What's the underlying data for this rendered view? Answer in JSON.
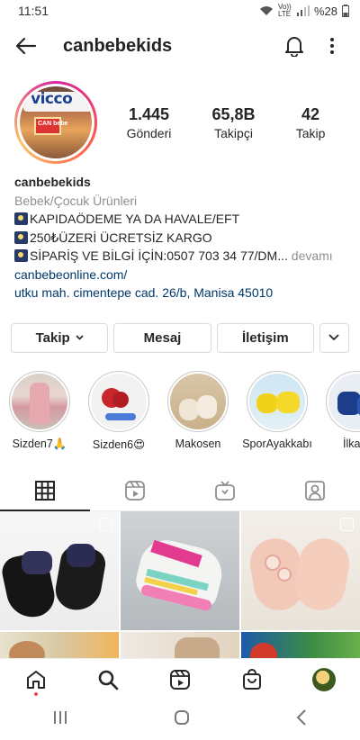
{
  "status": {
    "time": "11:51",
    "network": "Vo)) LTE",
    "battery": "%28"
  },
  "header": {
    "username": "canbebekids"
  },
  "profile": {
    "stats": [
      {
        "num": "1.445",
        "label": "Gönderi"
      },
      {
        "num": "65,8B",
        "label": "Takipçi"
      },
      {
        "num": "42",
        "label": "Takip"
      }
    ],
    "avatar_logo": "vicco",
    "avatar_sign": "CAN bebe"
  },
  "bio": {
    "name": "canbebekids",
    "category": "Bebek/Çocuk Ürünleri",
    "line1": "KAPIDAÖDEME YA DA HAVALE/EFT",
    "line2": "250₺ÜZERİ ÜCRETSİZ KARGO",
    "line3": "SİPARİŞ VE BİLGİ İÇİN:0507 703 34 77/DM...",
    "more": " devamı",
    "website": "canbebeonline.com/",
    "address": "utku mah. cimentepe cad. 26/b, Manisa 45010"
  },
  "buttons": {
    "follow": "Takip",
    "message": "Mesaj",
    "contact": "İletişim"
  },
  "highlights": [
    {
      "label": "Sizden7🙏"
    },
    {
      "label": "Sizden6😍"
    },
    {
      "label": "Makosen"
    },
    {
      "label": "SporAyakkabı"
    },
    {
      "label": "İlkadı"
    }
  ],
  "colors": {
    "accent_red": "#ed4956",
    "link": "#00376b",
    "muted": "#8e8e8e"
  }
}
